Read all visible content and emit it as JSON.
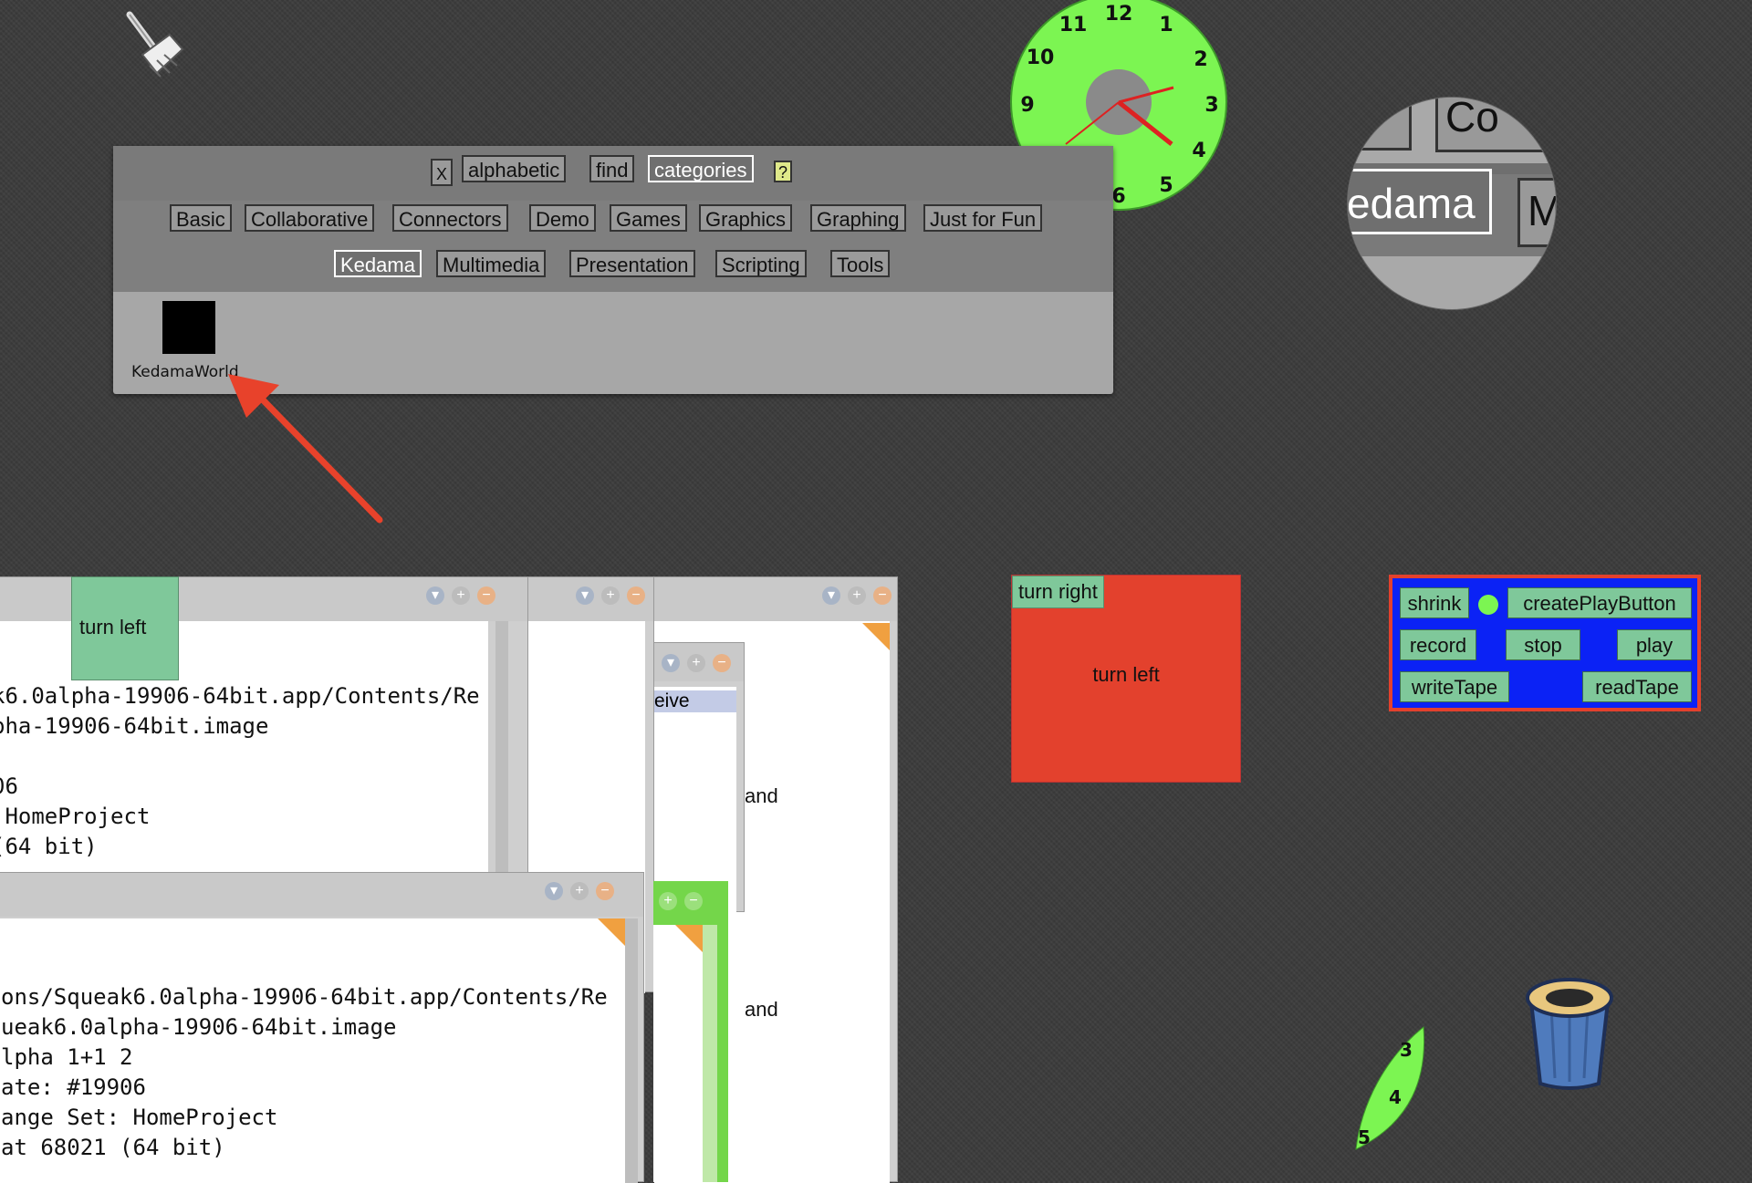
{
  "catalog": {
    "close_label": "X",
    "tabs": [
      "alphabetic",
      "find",
      "categories"
    ],
    "help_label": "?",
    "categories_row1": [
      "Basic",
      "Collaborative",
      "Connectors",
      "Demo",
      "Games",
      "Graphics",
      "Graphing",
      "Just for Fun"
    ],
    "categories_row2": [
      "Kedama",
      "Multimedia",
      "Presentation",
      "Scripting",
      "Tools"
    ],
    "selected_category": "Kedama",
    "item_label": "KedamaWorld"
  },
  "clock": {
    "numbers": [
      "12",
      "1",
      "2",
      "3",
      "4",
      "5",
      "6",
      "10",
      "11",
      "9"
    ],
    "face_color": "#7cf552"
  },
  "magnifier": {
    "text_top": "Co",
    "text_main": "edama",
    "text_side": "M"
  },
  "tiles": {
    "turn_left_tile": "turn left",
    "turn_right_tile": "turn right",
    "player_turn_left": "turn left",
    "player_color": "#e3412d"
  },
  "recorder": {
    "shrink": "shrink",
    "create_play": "createPlayButton",
    "record": "record",
    "stop": "stop",
    "play": "play",
    "write_tape": "writeTape",
    "read_tape": "readTape"
  },
  "workspace_back": {
    "lines": [
      "k6.0alpha-19906-64bit.app/Contents/Re",
      "pha-19906-64bit.image",
      "",
      "06",
      " HomeProject",
      "(64 bit)"
    ]
  },
  "workspace_front": {
    "lines": [
      "ons/Squeak6.0alpha-19906-64bit.app/Contents/Re",
      "ueak6.0alpha-19906-64bit.image",
      "lpha 1+1 2",
      "ate: #19906",
      "ange Set: HomeProject",
      "at 68021 (64 bit)"
    ]
  },
  "middle_window": {
    "list_item": "eive",
    "and_1": "and",
    "and_2": "and"
  },
  "leaf": {
    "numbers": [
      "3",
      "4",
      "5"
    ]
  }
}
